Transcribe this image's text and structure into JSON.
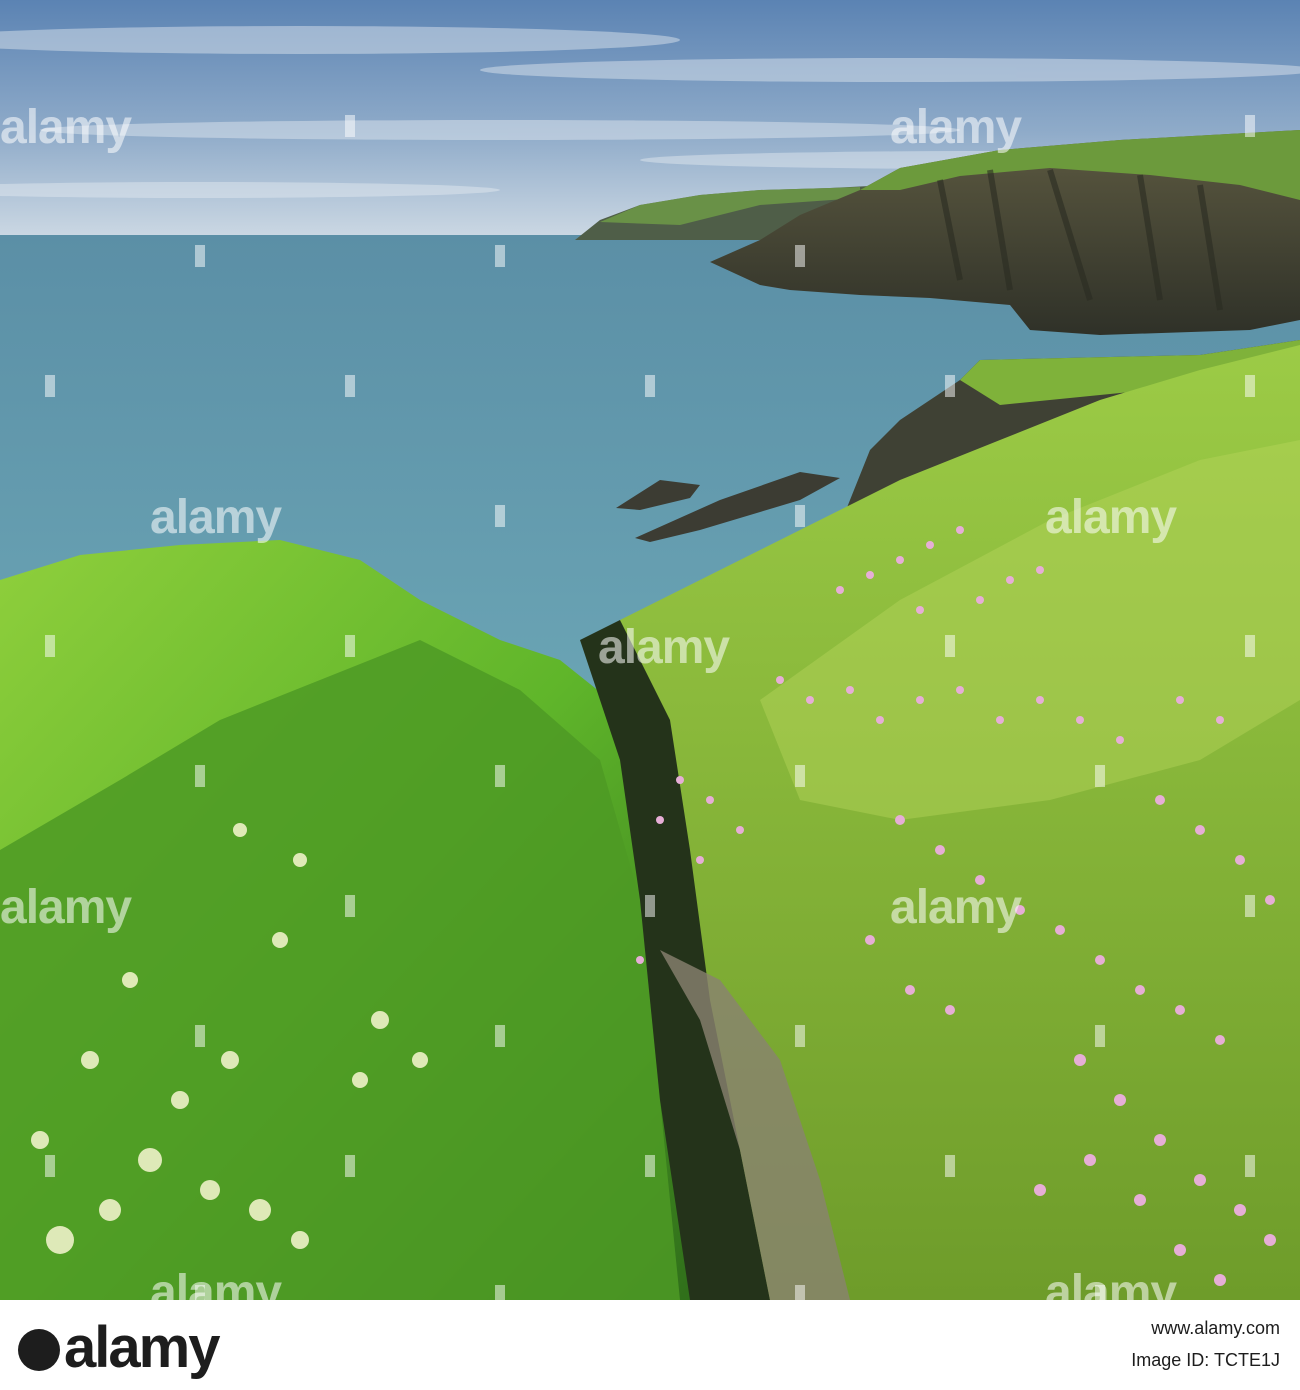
{
  "photo": {
    "scene": "coastal-cliffs",
    "colors": {
      "sky_top": "#5f86b5",
      "sky_horizon": "#c9d6e3",
      "sea": "#5a93a8",
      "sea_near": "#6aa7b6",
      "grass": "#6bbf2a",
      "grass_dark": "#3a7a1a",
      "cliff": "#4a4a3c",
      "thrift": "#e7b2d8"
    }
  },
  "watermark": {
    "text": "alamy"
  },
  "footer": {
    "logo": "alamy",
    "image_id": "Image ID: TCTE1J",
    "url": "www.alamy.com"
  }
}
